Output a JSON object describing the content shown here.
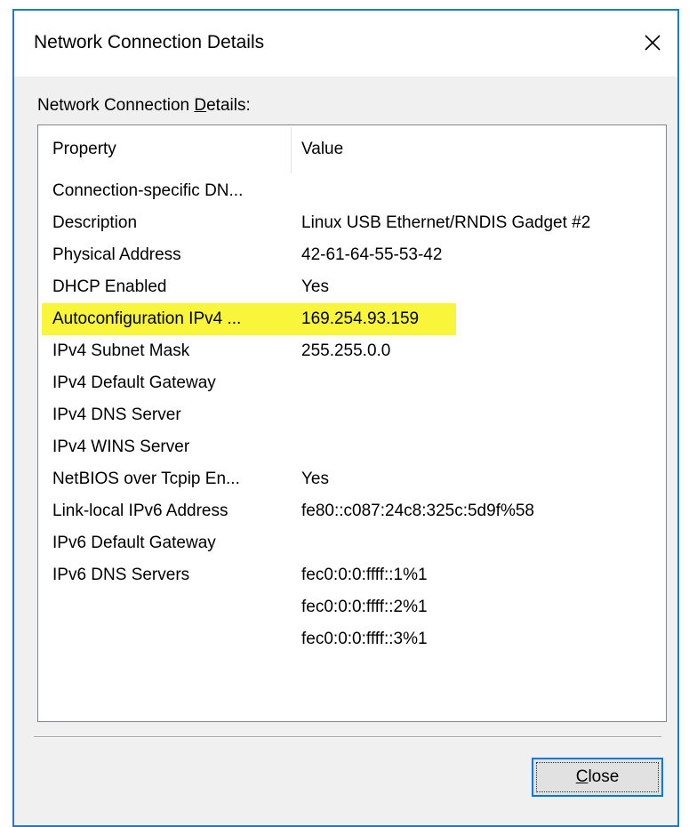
{
  "window": {
    "title": "Network Connection Details"
  },
  "group_label": {
    "first_part": "Network Connection ",
    "underlined": "D",
    "rest": "etails:"
  },
  "list": {
    "columns": {
      "property": "Property",
      "value": "Value"
    },
    "rows": [
      {
        "property": "Connection-specific DN...",
        "value": ""
      },
      {
        "property": "Description",
        "value": "Linux USB Ethernet/RNDIS Gadget #2"
      },
      {
        "property": "Physical Address",
        "value": "42-61-64-55-53-42"
      },
      {
        "property": "DHCP Enabled",
        "value": "Yes"
      },
      {
        "property": "Autoconfiguration IPv4 ...",
        "value": "169.254.93.159",
        "highlighted": true
      },
      {
        "property": "IPv4 Subnet Mask",
        "value": "255.255.0.0"
      },
      {
        "property": "IPv4 Default Gateway",
        "value": ""
      },
      {
        "property": "IPv4 DNS Server",
        "value": ""
      },
      {
        "property": "IPv4 WINS Server",
        "value": ""
      },
      {
        "property": "NetBIOS over Tcpip En...",
        "value": "Yes"
      },
      {
        "property": "Link-local IPv6 Address",
        "value": "fe80::c087:24c8:325c:5d9f%58"
      },
      {
        "property": "IPv6 Default Gateway",
        "value": ""
      },
      {
        "property": "IPv6 DNS Servers",
        "value": "fec0:0:0:ffff::1%1"
      },
      {
        "property": "",
        "value": "fec0:0:0:ffff::2%1"
      },
      {
        "property": "",
        "value": "fec0:0:0:ffff::3%1"
      }
    ],
    "highlight_color": "#f8f53a"
  },
  "buttons": {
    "close": {
      "underlined": "C",
      "rest": "lose"
    }
  },
  "icons": {
    "close": "close-icon"
  },
  "colors": {
    "window_border": "#1c7ad0",
    "button_focus": "#0078d7"
  }
}
